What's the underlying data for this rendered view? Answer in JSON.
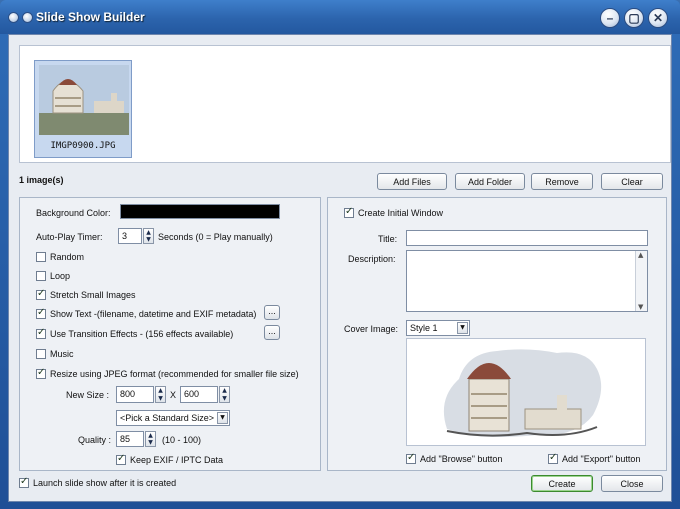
{
  "window": {
    "title": "Slide Show Builder",
    "minimize_glyph": "–",
    "maximize_glyph": "▢",
    "close_glyph": "✕"
  },
  "files": {
    "items": [
      {
        "name": "IMGP0900.JPG"
      }
    ],
    "count_label": "1 image(s)"
  },
  "file_buttons": {
    "add_files": "Add Files",
    "add_folder": "Add Folder",
    "remove": "Remove",
    "clear": "Clear"
  },
  "settings": {
    "background_color_label": "Background Color:",
    "background_color_value": "#000000",
    "autoplay_label": "Auto-Play Timer:",
    "autoplay_value": "3",
    "autoplay_hint": "Seconds (0 = Play  manually)",
    "random": {
      "label": "Random",
      "checked": false
    },
    "loop": {
      "label": "Loop",
      "checked": false
    },
    "stretch": {
      "label": "Stretch Small Images",
      "checked": true
    },
    "show_text": {
      "label": "Show Text -(filename, datetime and EXIF metadata)",
      "checked": true
    },
    "transitions": {
      "label": "Use Transition Effects   -    (156 effects available)",
      "checked": true
    },
    "music": {
      "label": "Music",
      "checked": false
    },
    "resize": {
      "label": "Resize using JPEG format (recommended for smaller file size)",
      "checked": true
    },
    "new_size_label": "New Size :",
    "width_value": "800",
    "x_label": "X",
    "height_value": "600",
    "standard_size": "<Pick a Standard Size>",
    "quality_label": "Quality :",
    "quality_value": "85",
    "quality_range": "(10 - 100)",
    "keep_exif": {
      "label": "Keep EXIF / IPTC Data",
      "checked": true
    },
    "ellipsis": "..."
  },
  "initial_window": {
    "create": {
      "label": "Create Initial Window",
      "checked": true
    },
    "title_label": "Title:",
    "title_value": "",
    "description_label": "Description:",
    "description_value": "",
    "cover_label": "Cover Image:",
    "cover_value": "Style 1",
    "add_browse": {
      "label": "Add \"Browse\" button",
      "checked": true
    },
    "add_export": {
      "label": "Add \"Export\" button",
      "checked": true
    }
  },
  "footer": {
    "launch": {
      "label": "Launch slide show after it is created",
      "checked": true
    },
    "create_label": "Create",
    "close_label": "Close"
  }
}
